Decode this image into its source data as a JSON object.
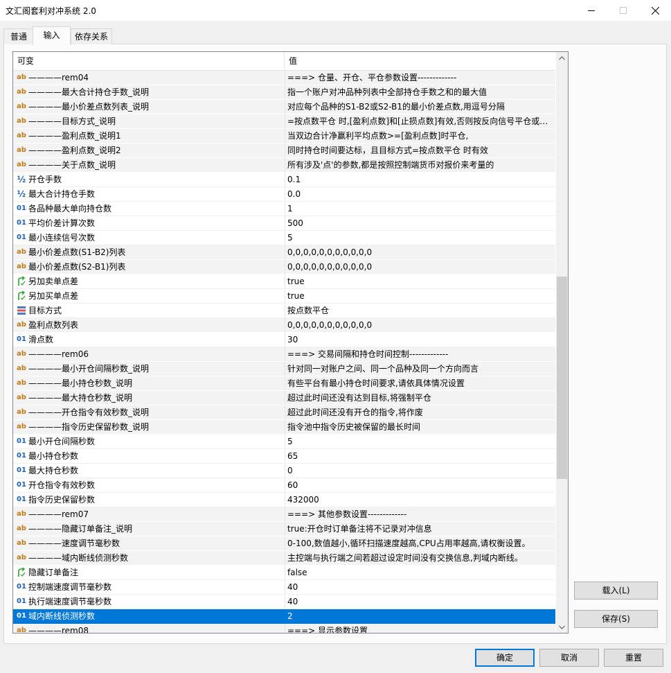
{
  "window": {
    "title": "文汇阁套利对冲系统 2.0"
  },
  "tabs": [
    {
      "label": "普通"
    },
    {
      "label": "输入"
    },
    {
      "label": "依存关系"
    }
  ],
  "grid": {
    "columns": {
      "name": "可变",
      "value": "值"
    },
    "rows": [
      {
        "icon": "ab",
        "name": "————rem04",
        "value": "===> 仓量、开仓、平仓参数设置-------------"
      },
      {
        "icon": "ab",
        "name": "————最大合计持仓手数_说明",
        "value": "指一个账户对冲品种列表中全部持仓手数之和的最大值"
      },
      {
        "icon": "ab",
        "name": "————最小价差点数列表_说明",
        "value": "对应每个品种的S1-B2或S2-B1的最小价差点数,用逗号分隔"
      },
      {
        "icon": "ab",
        "name": "————目标方式_说明",
        "value": "=按点数平仓 时,[盈利点数]和[止损点数]有效,否则按反向信号平仓或不..."
      },
      {
        "icon": "ab",
        "name": "————盈利点数_说明1",
        "value": "当双边合计净赢利平均点数>=[盈利点数]时平仓,"
      },
      {
        "icon": "ab",
        "name": "————盈利点数_说明2",
        "value": "  同时持仓时间要达标，且目标方式=按点数平仓 时有效"
      },
      {
        "icon": "ab",
        "name": "————关于点数_说明",
        "value": "所有涉及'点'的参数,都是按照控制端货币对报价来考量的"
      },
      {
        "icon": "half",
        "name": "开仓手数",
        "value": "0.1"
      },
      {
        "icon": "half",
        "name": "最大合计持仓手数",
        "value": "0.0"
      },
      {
        "icon": "num",
        "name": "各品种最大单向持仓数",
        "value": "1"
      },
      {
        "icon": "num",
        "name": "平均价差计算次数",
        "value": "500"
      },
      {
        "icon": "num",
        "name": "最小连续信号次数",
        "value": "5"
      },
      {
        "icon": "ab",
        "name": "最小价差点数(S1-B2)列表",
        "value": "0,0,0,0,0,0,0,0,0,0,0"
      },
      {
        "icon": "ab",
        "name": "最小价差点数(S2-B1)列表",
        "value": "0,0,0,0,0,0,0,0,0,0,0"
      },
      {
        "icon": "bool",
        "name": "另加卖单点差",
        "value": "true"
      },
      {
        "icon": "bool",
        "name": "另加买单点差",
        "value": "true"
      },
      {
        "icon": "enum",
        "name": "目标方式",
        "value": "按点数平仓"
      },
      {
        "icon": "ab",
        "name": "盈利点数列表",
        "value": "0,0,0,0,0,0,0,0,0,0,0"
      },
      {
        "icon": "num",
        "name": "滑点数",
        "value": "30"
      },
      {
        "icon": "ab",
        "name": "————rem06",
        "value": "===> 交易间隔和持仓时间控制-------------"
      },
      {
        "icon": "ab",
        "name": "————最小开仓间隔秒数_说明",
        "value": "针对同一对账户之间、同一个品种及同一个方向而言"
      },
      {
        "icon": "ab",
        "name": "————最小持仓秒数_说明",
        "value": "有些平台有最小持仓时间要求,请依具体情况设置"
      },
      {
        "icon": "ab",
        "name": "————最大持仓秒数_说明",
        "value": "超过此时间还没有达到目标,将强制平仓"
      },
      {
        "icon": "ab",
        "name": "————开仓指令有效秒数_说明",
        "value": "超过此时间还没有开仓的指令,将作废"
      },
      {
        "icon": "ab",
        "name": "————指令历史保留秒数_说明",
        "value": "指令池中指令历史被保留的最长时间"
      },
      {
        "icon": "num",
        "name": "最小开仓间隔秒数",
        "value": "5"
      },
      {
        "icon": "num",
        "name": "最小持仓秒数",
        "value": "65"
      },
      {
        "icon": "num",
        "name": "最大持仓秒数",
        "value": "0"
      },
      {
        "icon": "num",
        "name": "开仓指令有效秒数",
        "value": "60"
      },
      {
        "icon": "num",
        "name": "指令历史保留秒数",
        "value": "432000"
      },
      {
        "icon": "ab",
        "name": "————rem07",
        "value": "===> 其他参数设置-------------"
      },
      {
        "icon": "ab",
        "name": "————隐藏订单备注_说明",
        "value": "true:开仓时订单备注将不记录对冲信息"
      },
      {
        "icon": "ab",
        "name": "————速度调节毫秒数",
        "value": "0-100,数值越小,循环扫描速度越高,CPU占用率越高,请权衡设置。"
      },
      {
        "icon": "ab",
        "name": "————域内断线侦测秒数",
        "value": "主控端与执行端之间若超过设定时间没有交换信息,判域内断线。"
      },
      {
        "icon": "bool",
        "name": "隐藏订单备注",
        "value": "false"
      },
      {
        "icon": "num",
        "name": "控制端速度调节毫秒数",
        "value": "40"
      },
      {
        "icon": "num",
        "name": "执行端速度调节毫秒数",
        "value": "40"
      },
      {
        "icon": "num",
        "name": "域内断线侦测秒数",
        "value": "2",
        "selected": true
      },
      {
        "icon": "ab",
        "name": "————rem08",
        "value": "===> 显示参数设置"
      }
    ]
  },
  "icon_glyphs": {
    "ab": "ab",
    "num": "01",
    "half": "½"
  },
  "side_buttons": {
    "load": "载入(L)",
    "save": "保存(S)"
  },
  "footer": {
    "ok": "确定",
    "cancel": "取消",
    "reset": "重置"
  },
  "colors": {
    "selection": "#0078d7",
    "window_bg": "#f0f0f0"
  }
}
